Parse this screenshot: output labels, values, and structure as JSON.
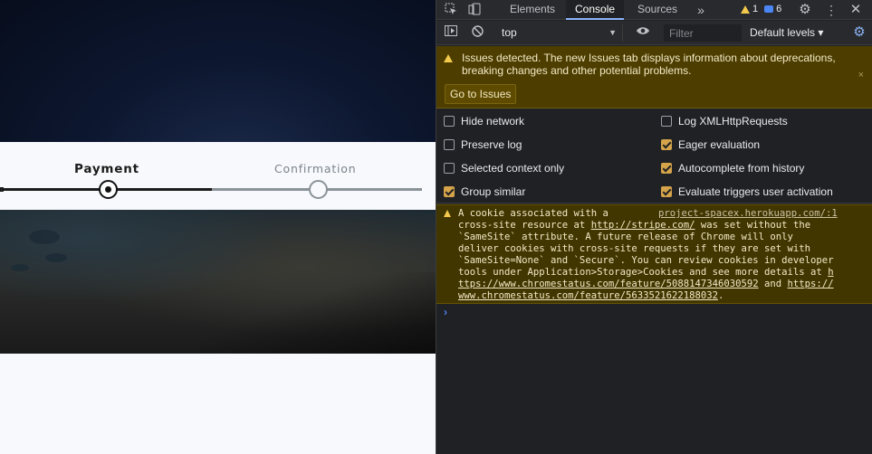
{
  "page": {
    "stepper": {
      "steps": [
        {
          "label": "Payment",
          "state": "current"
        },
        {
          "label": "Confirmation",
          "state": "upcoming"
        }
      ]
    }
  },
  "devtools": {
    "tabs": [
      "Elements",
      "Console",
      "Sources"
    ],
    "active_tab": "Console",
    "more_tabs_icon": "»",
    "warning_count": "1",
    "message_count": "6",
    "toolbar": {
      "context": "top",
      "filter_placeholder": "Filter",
      "levels": "Default levels ▾"
    },
    "issues_banner": {
      "text": "Issues detected. The new Issues tab displays information about deprecations, breaking changes and other potential problems.",
      "button": "Go to Issues",
      "close": "×"
    },
    "settings": {
      "left": [
        {
          "label": "Hide network",
          "checked": false
        },
        {
          "label": "Preserve log",
          "checked": false
        },
        {
          "label": "Selected context only",
          "checked": false
        },
        {
          "label": "Group similar",
          "checked": true
        }
      ],
      "right": [
        {
          "label": "Log XMLHttpRequests",
          "checked": false
        },
        {
          "label": "Eager evaluation",
          "checked": true
        },
        {
          "label": "Autocomplete from history",
          "checked": true
        },
        {
          "label": "Evaluate triggers user activation",
          "checked": true
        }
      ]
    },
    "console_warning": {
      "source_link": "project-spacex.herokuapp.com/:1",
      "line1": "A cookie associated with a",
      "line2_pre": "cross-site resource at ",
      "line2_link": "http://stripe.com/",
      "line2_post": " was set without the",
      "line3": "`SameSite` attribute. A future release of Chrome will only",
      "line4": "deliver cookies with cross-site requests if they are set with",
      "line5": "`SameSite=None` and `Secure`. You can review cookies in developer",
      "line6_pre": "tools under Application>Storage>Cookies and see more details at ",
      "line6_link": "h",
      "line7_link": "ttps://www.chromestatus.com/feature/5088147346030592",
      "line7_mid": " and ",
      "line7_link2": "https://",
      "line8_link": "www.chromestatus.com/feature/5633521622188032",
      "line8_post": "."
    },
    "prompt": "›"
  }
}
